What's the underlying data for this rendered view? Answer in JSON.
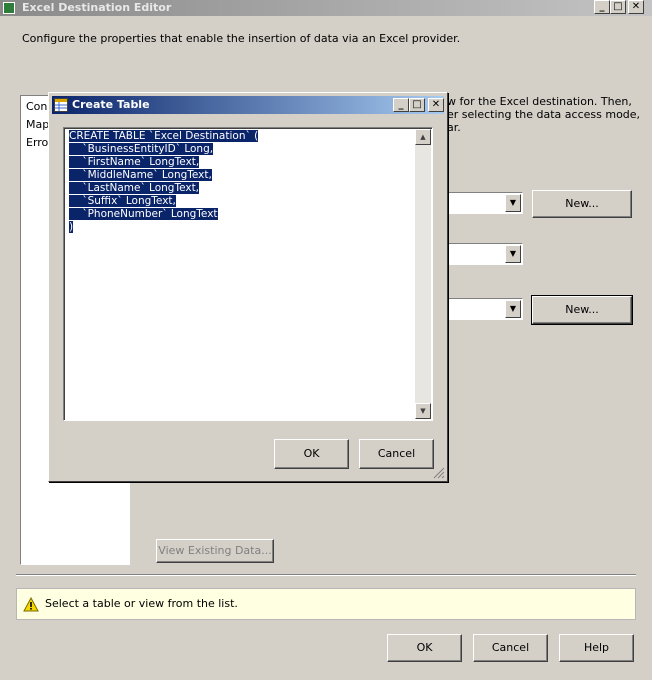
{
  "window": {
    "title": "Excel Destination Editor",
    "description": "Configure the properties that enable the insertion of data via an Excel provider."
  },
  "left_nav": {
    "items": [
      "Conn",
      "Mapp",
      "Error"
    ]
  },
  "instructions": {
    "line1": "w for the Excel destination. Then,",
    "line2": "er selecting the data access mode,",
    "line3": "ar."
  },
  "buttons": {
    "new1": "New...",
    "new2": "New...",
    "view_existing": "View Existing Data...",
    "ok": "OK",
    "cancel": "Cancel",
    "help": "Help"
  },
  "dialog": {
    "title": "Create Table",
    "code_lines": [
      "CREATE TABLE `Excel Destination` (",
      "    `BusinessEntityID` Long,",
      "    `FirstName` LongText,",
      "    `MiddleName` LongText,",
      "    `LastName` LongText,",
      "    `Suffix` LongText,",
      "    `PhoneNumber` LongText",
      ")"
    ],
    "ok": "OK",
    "cancel": "Cancel"
  },
  "status": {
    "message": "Select a table or view from the list.",
    "icon": "warning-icon"
  }
}
